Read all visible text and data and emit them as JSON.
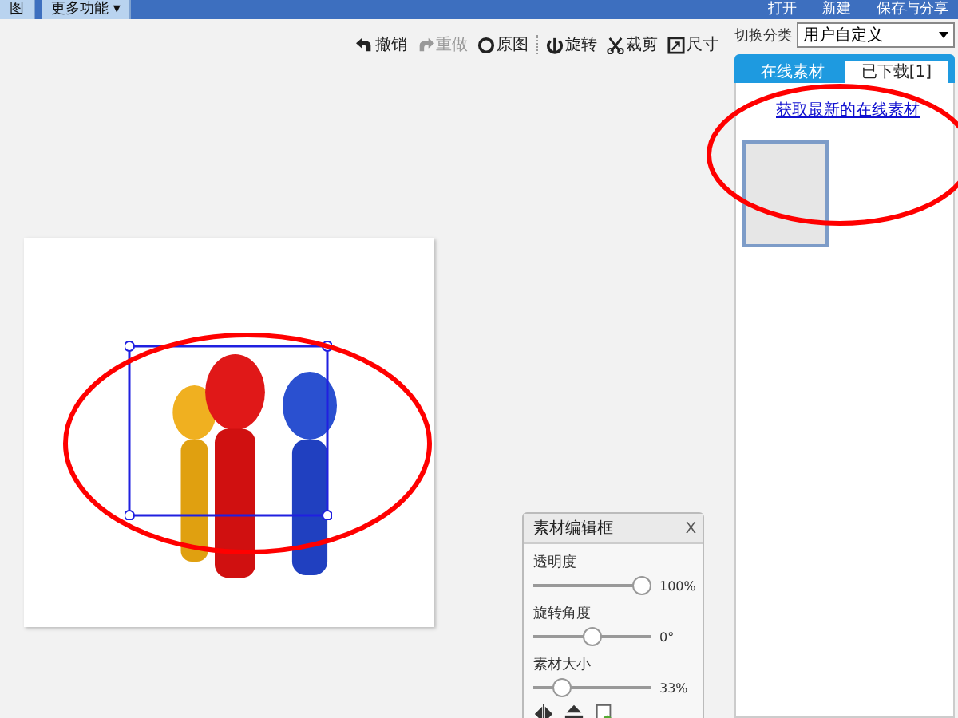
{
  "top_bar": {
    "tabs": [
      {
        "label": "图"
      },
      {
        "label": "更多功能 ▾"
      }
    ],
    "actions": [
      "打开",
      "新建",
      "保存与分享"
    ]
  },
  "toolbar": [
    {
      "label": "撤销",
      "kind": "undo",
      "disabled": false
    },
    {
      "label": "重做",
      "kind": "redo",
      "disabled": true
    },
    {
      "label": "原图",
      "kind": "original",
      "disabled": false
    },
    {
      "label": "旋转",
      "kind": "rotate",
      "disabled": false
    },
    {
      "label": "裁剪",
      "kind": "cut",
      "disabled": false
    },
    {
      "label": "尺寸",
      "kind": "size",
      "disabled": false
    }
  ],
  "category": {
    "label": "切换分类",
    "value": "用户自定义"
  },
  "material_tabs": [
    {
      "label": "在线素材",
      "selected": false
    },
    {
      "label": "已下载[1]",
      "selected": true
    }
  ],
  "panel_link": "获取最新的在线素材",
  "editor": {
    "title": "素材编辑框",
    "close": "X",
    "sliders": [
      {
        "label": "透明度",
        "level": 1,
        "reading": "100%"
      },
      {
        "label": "旋转角度",
        "level": 0.5,
        "reading": "0°"
      },
      {
        "label": "素材大小",
        "level": 0.2,
        "reading": "33%"
      }
    ]
  }
}
